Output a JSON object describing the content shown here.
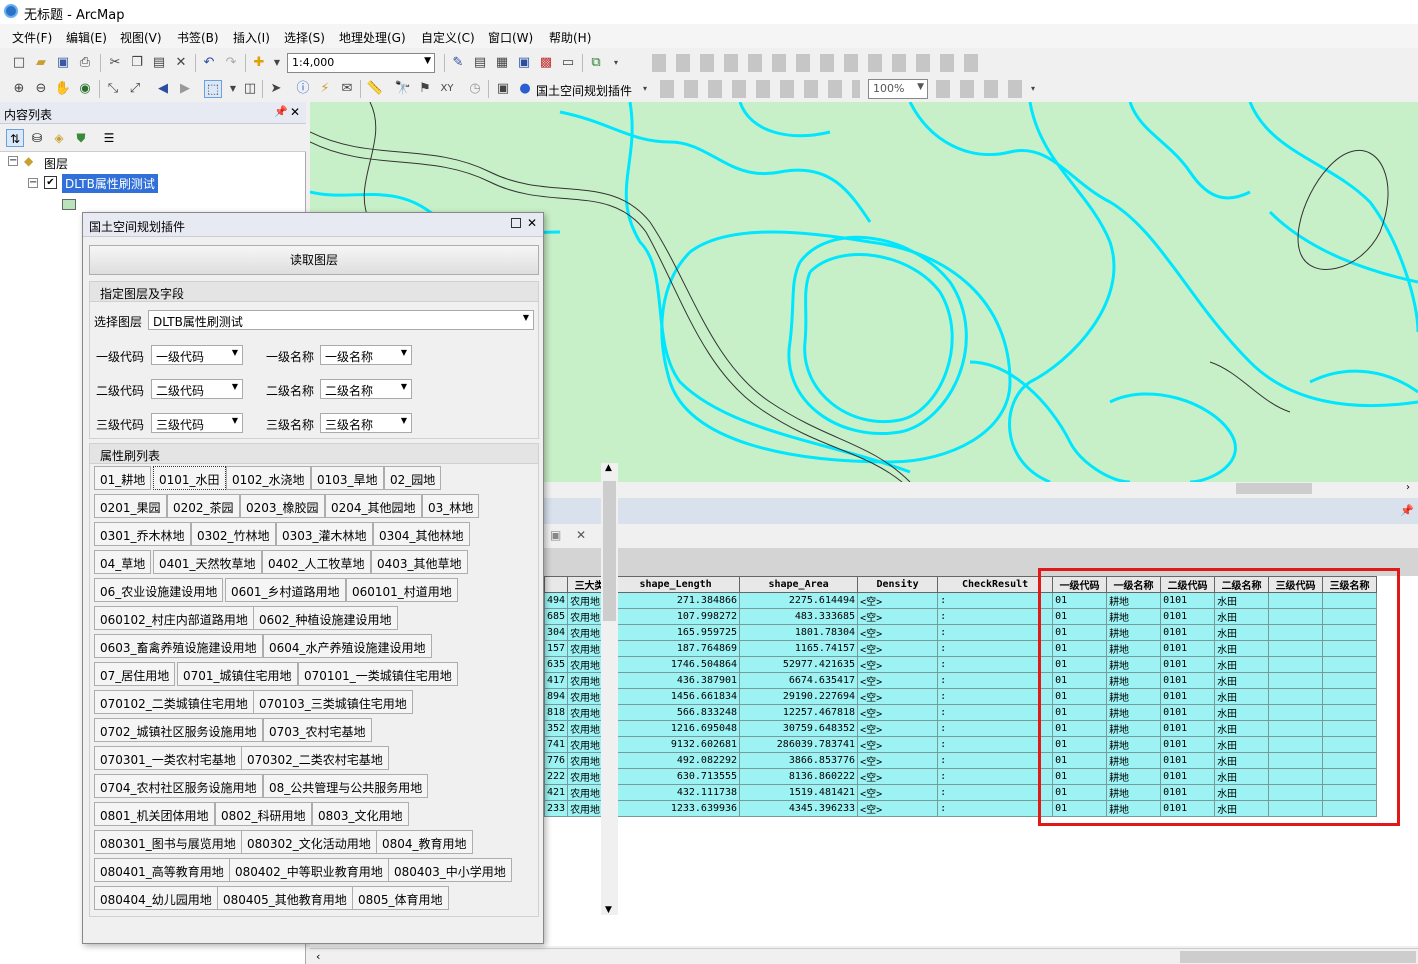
{
  "window": {
    "title": "无标题 - ArcMap"
  },
  "menu": [
    "文件(F)",
    "编辑(E)",
    "视图(V)",
    "书签(B)",
    "插入(I)",
    "选择(S)",
    "地理处理(G)",
    "自定义(C)",
    "窗口(W)",
    "帮助(H)"
  ],
  "toolbar": {
    "scale": "1:4,000",
    "plugin_label": "国土空间规划插件",
    "zoom": "100%"
  },
  "toc": {
    "title": "内容列表",
    "root": "图层",
    "layer": "DLTB属性刷测试",
    "color": "#b9e4b9"
  },
  "map": {
    "bg": "#c8f0c8",
    "line": "#00e6ff"
  },
  "dock": {
    "title": "国土空间规划插件",
    "read_button": "读取图层",
    "section1": "指定图层及字段",
    "select_layer_label": "选择图层",
    "select_layer_value": "DLTB属性刷测试",
    "fields": [
      {
        "label": "一级代码",
        "value": "一级代码"
      },
      {
        "label": "一级名称",
        "value": "一级名称"
      },
      {
        "label": "二级代码",
        "value": "二级代码"
      },
      {
        "label": "二级名称",
        "value": "二级名称"
      },
      {
        "label": "三级代码",
        "value": "三级代码"
      },
      {
        "label": "三级名称",
        "value": "三级名称"
      }
    ],
    "section2": "属性刷列表",
    "tags": [
      [
        "01_耕地",
        "0101_水田",
        "0102_水浇地",
        "0103_旱地",
        "02_园地"
      ],
      [
        "0201_果园",
        "0202_茶园",
        "0203_橡胶园",
        "0204_其他园地",
        "03_林地"
      ],
      [
        "0301_乔木林地",
        "0302_竹林地",
        "0303_灌木林地",
        "0304_其他林地"
      ],
      [
        "04_草地",
        "0401_天然牧草地",
        "0402_人工牧草地",
        "0403_其他草地"
      ],
      [
        "06_农业设施建设用地",
        "0601_乡村道路用地",
        "060101_村道用地"
      ],
      [
        "060102_村庄内部道路用地",
        "0602_种植设施建设用地"
      ],
      [
        "0603_畜禽养殖设施建设用地",
        "0604_水产养殖设施建设用地"
      ],
      [
        "07_居住用地",
        "0701_城镇住宅用地",
        "070101_一类城镇住宅用地"
      ],
      [
        "070102_二类城镇住宅用地",
        "070103_三类城镇住宅用地"
      ],
      [
        "0702_城镇社区服务设施用地",
        "0703_农村宅基地"
      ],
      [
        "070301_一类农村宅基地",
        "070302_二类农村宅基地"
      ],
      [
        "0704_农村社区服务设施用地",
        "08_公共管理与公共服务用地"
      ],
      [
        "0801_机关团体用地",
        "0802_科研用地",
        "0803_文化用地"
      ],
      [
        "080301_图书与展览用地",
        "080302_文化活动用地",
        "0804_教育用地"
      ],
      [
        "080401_高等教育用地",
        "080402_中等职业教育用地",
        "080403_中小学用地"
      ],
      [
        "080404_幼儿园用地",
        "080405_其他教育用地",
        "0805_体育用地"
      ]
    ]
  },
  "table": {
    "headers": [
      "",
      "三大类",
      "shape_Length",
      "shape_Area",
      "Density",
      "CheckResult",
      "一级代码",
      "一级名称",
      "二级代码",
      "二级名称",
      "三级代码",
      "三级名称"
    ],
    "rows": [
      [
        "494",
        "农用地",
        "271.384866",
        "2275.614494",
        "<空>",
        ":",
        "01",
        "耕地",
        "0101",
        "水田",
        "",
        ""
      ],
      [
        "685",
        "农用地",
        "107.998272",
        "483.333685",
        "<空>",
        ":",
        "01",
        "耕地",
        "0101",
        "水田",
        "",
        ""
      ],
      [
        "304",
        "农用地",
        "165.959725",
        "1801.78304",
        "<空>",
        ":",
        "01",
        "耕地",
        "0101",
        "水田",
        "",
        ""
      ],
      [
        "157",
        "农用地",
        "187.764869",
        "1165.74157",
        "<空>",
        ":",
        "01",
        "耕地",
        "0101",
        "水田",
        "",
        ""
      ],
      [
        "635",
        "农用地",
        "1746.504864",
        "52977.421635",
        "<空>",
        ":",
        "01",
        "耕地",
        "0101",
        "水田",
        "",
        ""
      ],
      [
        "417",
        "农用地",
        "436.387901",
        "6674.635417",
        "<空>",
        ":",
        "01",
        "耕地",
        "0101",
        "水田",
        "",
        ""
      ],
      [
        "894",
        "农用地",
        "1456.661834",
        "29190.227694",
        "<空>",
        ":",
        "01",
        "耕地",
        "0101",
        "水田",
        "",
        ""
      ],
      [
        "818",
        "农用地",
        "566.833248",
        "12257.467818",
        "<空>",
        ":",
        "01",
        "耕地",
        "0101",
        "水田",
        "",
        ""
      ],
      [
        "352",
        "农用地",
        "1216.695048",
        "30759.648352",
        "<空>",
        ":",
        "01",
        "耕地",
        "0101",
        "水田",
        "",
        ""
      ],
      [
        "741",
        "农用地",
        "9132.602681",
        "286039.783741",
        "<空>",
        ":",
        "01",
        "耕地",
        "0101",
        "水田",
        "",
        ""
      ],
      [
        "776",
        "农用地",
        "492.082292",
        "3866.853776",
        "<空>",
        ":",
        "01",
        "耕地",
        "0101",
        "水田",
        "",
        ""
      ],
      [
        "222",
        "农用地",
        "630.713555",
        "8136.860222",
        "<空>",
        ":",
        "01",
        "耕地",
        "0101",
        "水田",
        "",
        ""
      ],
      [
        "421",
        "农用地",
        "432.111738",
        "1519.481421",
        "<空>",
        ":",
        "01",
        "耕地",
        "0101",
        "水田",
        "",
        ""
      ],
      [
        "233",
        "农用地",
        "1233.639936",
        "4345.396233",
        "<空>",
        ":",
        "01",
        "耕地",
        "0101",
        "水田",
        "",
        ""
      ]
    ]
  }
}
